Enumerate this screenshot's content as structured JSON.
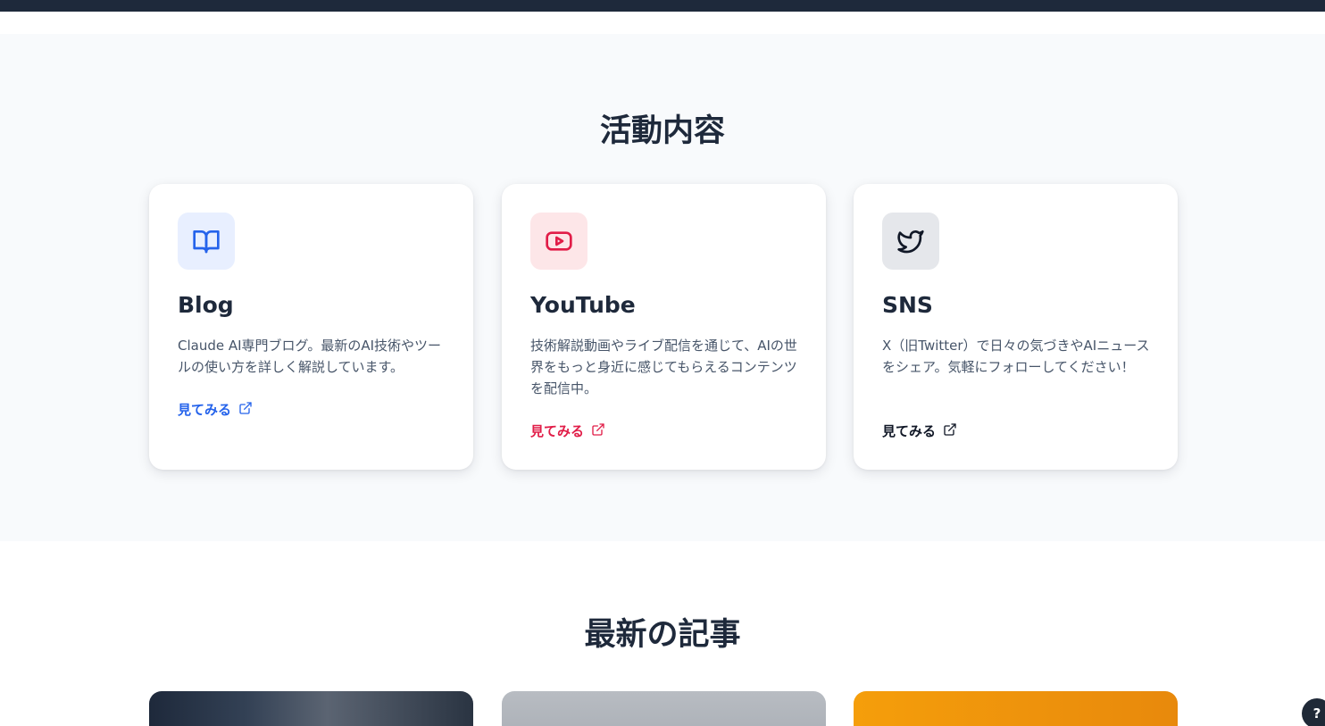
{
  "activities": {
    "title": "活動内容",
    "cards": [
      {
        "title": "Blog",
        "description": "Claude AI専門ブログ。最新のAI技術やツールの使い方を詳しく解説しています。",
        "link_label": "見てみる",
        "icon": "book-icon",
        "accent": "#2563eb",
        "icon_bg": "#e8efff"
      },
      {
        "title": "YouTube",
        "description": "技術解説動画やライブ配信を通じて、AIの世界をもっと身近に感じてもらえるコンテンツを配信中。",
        "link_label": "見てみる",
        "icon": "youtube-icon",
        "accent": "#e11d48",
        "icon_bg": "#fde6e8"
      },
      {
        "title": "SNS",
        "description": "X（旧Twitter）で日々の気づきやAIニュースをシェア。気軽にフォローしてください！",
        "link_label": "見てみる",
        "icon": "twitter-icon",
        "accent": "#111827",
        "icon_bg": "#e5e7eb"
      }
    ]
  },
  "latest": {
    "title": "最新の記事"
  },
  "help": {
    "label": "?"
  }
}
